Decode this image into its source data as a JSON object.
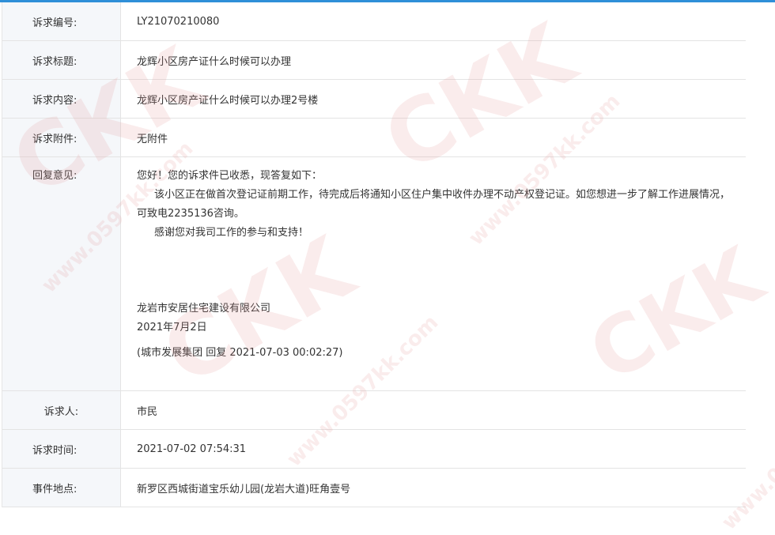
{
  "rows": {
    "number": {
      "label": "诉求编号:",
      "value": "LY21070210080"
    },
    "title": {
      "label": "诉求标题:",
      "value": "龙辉小区房产证什么时候可以办理"
    },
    "content": {
      "label": "诉求内容:",
      "value": "龙辉小区房产证什么时候可以办理2号楼"
    },
    "attachment": {
      "label": "诉求附件:",
      "value": "无附件"
    },
    "reply": {
      "label": "回复意见:",
      "greeting": "您好！您的诉求件已收悉，现答复如下：",
      "para1": "该小区正在做首次登记证前期工作，待完成后将通知小区住户集中收件办理不动产权登记证。如您想进一步了解工作进展情况，可致电2235136咨询。",
      "para2": "感谢您对我司工作的参与和支持！",
      "org": "龙岩市安居住宅建设有限公司",
      "date": "2021年7月2日",
      "note": "(城市发展集团 回复 2021-07-03 00:02:27)"
    },
    "petitioner": {
      "label": "诉求人:",
      "value": "市民"
    },
    "time": {
      "label": "诉求时间:",
      "value": "2021-07-02 07:54:31"
    },
    "location": {
      "label": "事件地点:",
      "value": "新罗区西城街道宝乐幼儿园(龙岩大道)旺角壹号"
    }
  },
  "watermark": {
    "text": "www.0597kk.com",
    "logo": "CKK"
  }
}
